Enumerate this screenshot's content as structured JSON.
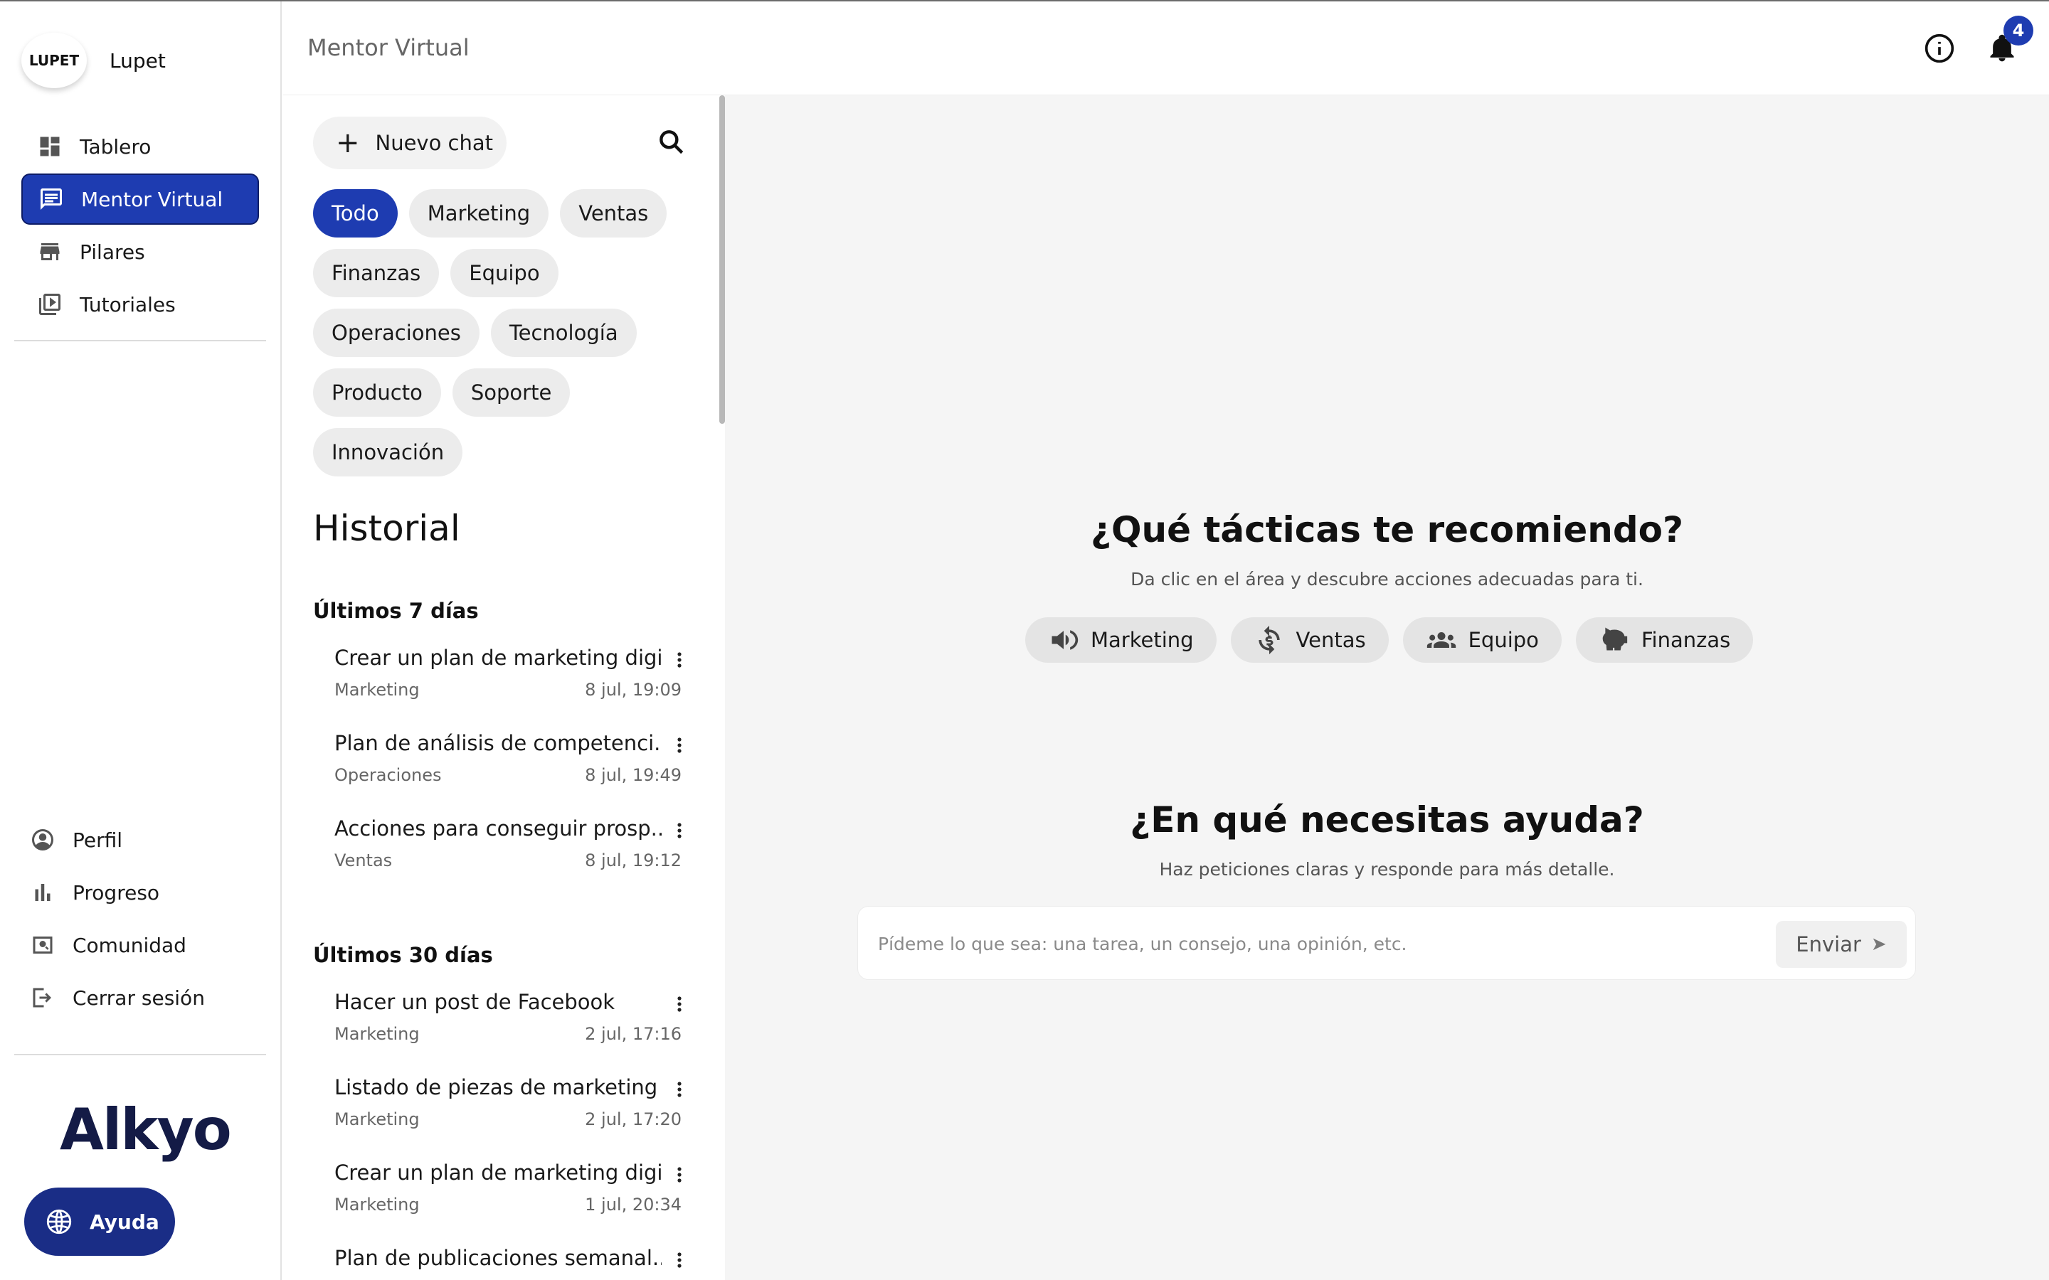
{
  "brand": {
    "logo_text": "LUPET",
    "name": "Lupet"
  },
  "nav": {
    "items": [
      {
        "label": "Tablero",
        "icon": "dashboard-icon",
        "active": false
      },
      {
        "label": "Mentor Virtual",
        "icon": "chat-icon",
        "active": true
      },
      {
        "label": "Pilares",
        "icon": "store-icon",
        "active": false
      },
      {
        "label": "Tutoriales",
        "icon": "video-library-icon",
        "active": false
      }
    ],
    "bottom": [
      {
        "label": "Perfil",
        "icon": "account-circle-icon"
      },
      {
        "label": "Progreso",
        "icon": "bar-chart-icon"
      },
      {
        "label": "Comunidad",
        "icon": "community-icon"
      },
      {
        "label": "Cerrar sesión",
        "icon": "logout-icon"
      }
    ]
  },
  "footer": {
    "logo": "Alkyo",
    "help_label": "Ayuda"
  },
  "header": {
    "title": "Mentor Virtual",
    "notifications_count": "4"
  },
  "chat_panel": {
    "new_chat_label": "Nuevo chat",
    "filters": [
      "Todo",
      "Marketing",
      "Ventas",
      "Finanzas",
      "Equipo",
      "Operaciones",
      "Tecnología",
      "Producto",
      "Soporte",
      "Innovación"
    ],
    "active_filter": "Todo",
    "history_title": "Historial",
    "groups": [
      {
        "title": "Últimos 7 días",
        "items": [
          {
            "name": "Crear un plan de marketing digi...",
            "category": "Marketing",
            "date": "8 jul, 19:09"
          },
          {
            "name": "Plan de análisis de competenci...",
            "category": "Operaciones",
            "date": "8 jul, 19:49"
          },
          {
            "name": "Acciones para conseguir prosp...",
            "category": "Ventas",
            "date": "8 jul, 19:12"
          }
        ]
      },
      {
        "title": "Últimos 30 días",
        "items": [
          {
            "name": "Hacer un post de Facebook",
            "category": "Marketing",
            "date": "2 jul, 17:16"
          },
          {
            "name": "Listado de piezas de marketing ...",
            "category": "Marketing",
            "date": "2 jul, 17:20"
          },
          {
            "name": "Crear un plan de marketing digi...",
            "category": "Marketing",
            "date": "1 jul, 20:34"
          },
          {
            "name": "Plan de publicaciones semanal...",
            "category": "",
            "date": ""
          }
        ]
      }
    ]
  },
  "main": {
    "tactics_title": "¿Qué tácticas te recomiendo?",
    "tactics_subtitle": "Da clic en el área y descubre acciones adecuadas para ti.",
    "tactics": [
      {
        "label": "Marketing",
        "icon": "megaphone-icon"
      },
      {
        "label": "Ventas",
        "icon": "money-cycle-icon"
      },
      {
        "label": "Equipo",
        "icon": "group-icon"
      },
      {
        "label": "Finanzas",
        "icon": "piggy-bank-icon"
      }
    ],
    "help_title": "¿En qué necesitas ayuda?",
    "help_subtitle": "Haz peticiones claras y responde para más detalle.",
    "input_placeholder": "Pídeme lo que sea: una tarea, un consejo, una opinión, etc.",
    "send_label": "Enviar"
  },
  "colors": {
    "accent": "#1e3cb1",
    "brand_dark": "#1a2d86",
    "main_bg": "#f5f5f5"
  }
}
